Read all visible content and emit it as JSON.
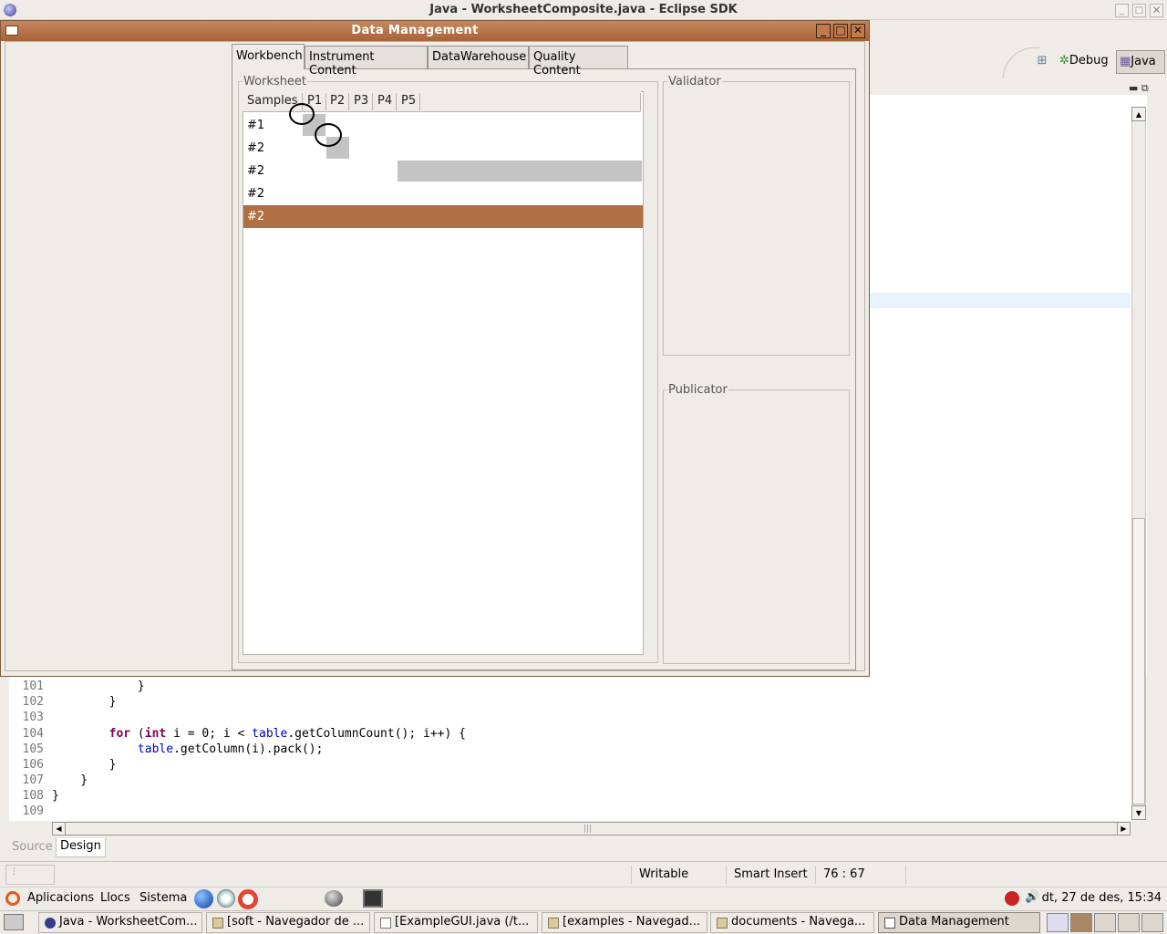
{
  "eclipse": {
    "title": "Java - WorksheetComposite.java - Eclipse SDK",
    "perspectives": [
      "Debug",
      "Java"
    ],
    "editor_tabs": [
      "Source",
      "Design"
    ],
    "code_lines": [
      {
        "num": "101",
        "text": "            }"
      },
      {
        "num": "102",
        "text": "        }"
      },
      {
        "num": "103",
        "text": ""
      },
      {
        "num": "104",
        "text": "        for (int i = 0; i < table.getColumnCount(); i++) {"
      },
      {
        "num": "105",
        "text": "            table.getColumn(i).pack();"
      },
      {
        "num": "106",
        "text": "        }"
      },
      {
        "num": "107",
        "text": "    }"
      },
      {
        "num": "108",
        "text": "}"
      },
      {
        "num": "109",
        "text": ""
      }
    ],
    "status": {
      "writable": "Writable",
      "insert_mode": "Smart Insert",
      "position": "76 : 67"
    }
  },
  "dialog": {
    "title": "Data Management",
    "tabs": [
      "Workbench",
      "Instrument Content",
      "DataWarehouse",
      "Quality Content"
    ],
    "selected_tab": "Workbench",
    "worksheet": {
      "legend": "Worksheet",
      "columns": [
        "Samples",
        "P1",
        "P2",
        "P3",
        "P4",
        "P5"
      ],
      "rows": [
        "#1",
        "#2",
        "#2",
        "#2",
        "#2"
      ],
      "selected_row_index": 4
    },
    "validator_legend": "Validator",
    "publicator_legend": "Publicator"
  },
  "panel": {
    "menus": [
      "Aplicacions",
      "Llocs",
      "Sistema"
    ],
    "clock": "dt, 27 de des, 15:34"
  },
  "taskbar": [
    {
      "label": "Java - WorksheetCom...",
      "icon": "eclipse-icon"
    },
    {
      "label": "[soft - Navegador de ...",
      "icon": "folder-icon"
    },
    {
      "label": "[ExampleGUI.java (/t...",
      "icon": "text-editor-icon"
    },
    {
      "label": "[examples - Navegad...",
      "icon": "folder-icon"
    },
    {
      "label": "documents - Navega...",
      "icon": "folder-icon"
    },
    {
      "label": "Data Management",
      "icon": "window-icon",
      "active": true
    }
  ],
  "colors": {
    "dialog_title_accent": "#b06e43",
    "selected_row": "#b06e43",
    "editor_highlight": "#e8f2fe"
  }
}
